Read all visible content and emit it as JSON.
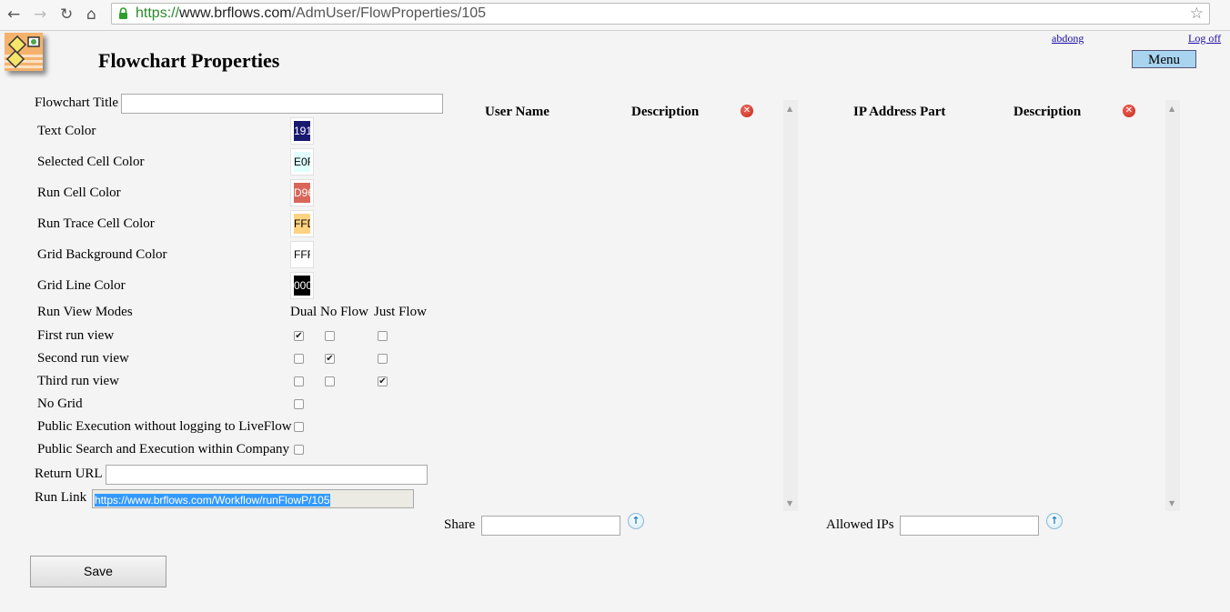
{
  "browser": {
    "url_scheme": "https://",
    "url_host": "www.brflows.com",
    "url_path": "/AdmUser/FlowProperties/105"
  },
  "header": {
    "title": "Flowchart Properties",
    "user_link": "abdong",
    "logoff_link": "Log off",
    "menu_label": "Menu"
  },
  "form": {
    "flowchart_title_label": "Flowchart Title",
    "flowchart_title_value": "",
    "colors": [
      {
        "label": "Text Color",
        "value": "191",
        "bg": "#191970",
        "fg": "#ffffff"
      },
      {
        "label": "Selected Cell Color",
        "value": "E0F",
        "bg": "#e0ffff",
        "fg": "#000000"
      },
      {
        "label": "Run Cell Color",
        "value": "D96",
        "bg": "#d9665a",
        "fg": "#ffffff"
      },
      {
        "label": "Run Trace Cell Color",
        "value": "FFD",
        "bg": "#ffd382",
        "fg": "#000000"
      },
      {
        "label": "Grid Background Color",
        "value": "FFF",
        "bg": "#ffffff",
        "fg": "#000000"
      },
      {
        "label": "Grid Line Color",
        "value": "000",
        "bg": "#000000",
        "fg": "#ffffff"
      }
    ],
    "run_view_modes_label": "Run View Modes",
    "mode_headers": [
      "Dual",
      "No Flow",
      "Just Flow"
    ],
    "run_views": [
      {
        "label": "First run view",
        "checks": [
          true,
          false,
          false
        ]
      },
      {
        "label": "Second run view",
        "checks": [
          false,
          true,
          false
        ]
      },
      {
        "label": "Third run view",
        "checks": [
          false,
          false,
          true
        ]
      }
    ],
    "options": [
      {
        "label": "No Grid",
        "checked": false
      },
      {
        "label": "Public Execution without logging to LiveFlow",
        "checked": false
      },
      {
        "label": "Public Search and Execution within Company",
        "checked": false
      }
    ],
    "return_url_label": "Return URL",
    "return_url_value": "",
    "run_link_label": "Run Link",
    "run_link_value": "https://www.brflows.com/Workflow/runFlowP/105",
    "save_label": "Save"
  },
  "share_panel": {
    "col_user": "User Name",
    "col_description": "Description",
    "input_label": "Share",
    "input_value": ""
  },
  "ip_panel": {
    "col_ip": "IP Address Part",
    "col_description": "Description",
    "input_label": "Allowed IPs",
    "input_value": ""
  }
}
